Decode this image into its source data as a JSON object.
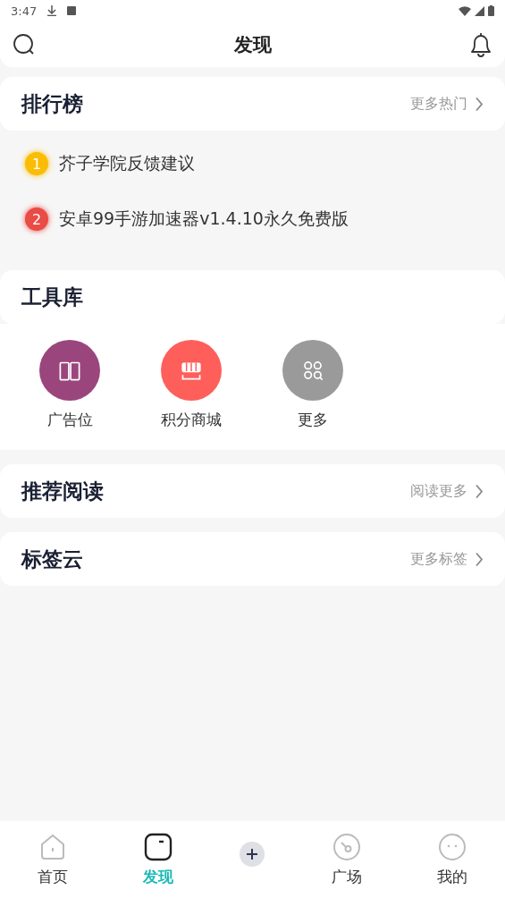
{
  "status_bar": {
    "time": "3:47"
  },
  "header": {
    "title": "发现"
  },
  "ranking": {
    "title": "排行榜",
    "more": "更多热门",
    "items": [
      {
        "rank": "1",
        "title": "芥子学院反馈建议",
        "color": "#fbbc05"
      },
      {
        "rank": "2",
        "title": "安卓99手游加速器v1.4.10永久免费版",
        "color": "#e94b45"
      }
    ]
  },
  "tools": {
    "title": "工具库",
    "items": [
      {
        "label": "广告位",
        "color": "#9a467d"
      },
      {
        "label": "积分商城",
        "color": "#fe5f5b"
      },
      {
        "label": "更多",
        "color": "#9a9a9a"
      }
    ]
  },
  "reading": {
    "title": "推荐阅读",
    "more": "阅读更多"
  },
  "tags": {
    "title": "标签云",
    "more": "更多标签"
  },
  "nav": [
    {
      "label": "首页",
      "selected": false
    },
    {
      "label": "发现",
      "selected": true
    },
    {
      "label": "广场",
      "selected": false
    },
    {
      "label": "我的",
      "selected": false
    }
  ]
}
